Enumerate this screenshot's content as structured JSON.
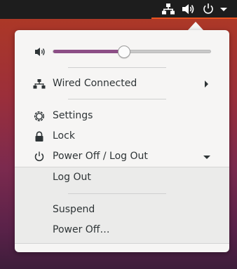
{
  "topbar": {
    "icons": [
      "network-wired-icon",
      "speaker-volume-icon",
      "power-icon",
      "dropdown-arrow-icon"
    ]
  },
  "menu": {
    "volume": {
      "icon": "speaker-volume-icon",
      "level_percent": 44
    },
    "wired": {
      "label": "Wired Connected",
      "icon": "network-wired-icon"
    },
    "settings": {
      "label": "Settings",
      "icon": "settings-gear-icon"
    },
    "lock": {
      "label": "Lock",
      "icon": "padlock-icon"
    },
    "power": {
      "label": "Power Off / Log Out",
      "icon": "power-icon",
      "submenu": {
        "log_out": "Log Out",
        "suspend": "Suspend",
        "power_off": "Power Off…"
      }
    }
  },
  "colors": {
    "accent": "#e95420",
    "slider_fill": "#8c4e86",
    "menu_bg": "#f6f5f4"
  }
}
